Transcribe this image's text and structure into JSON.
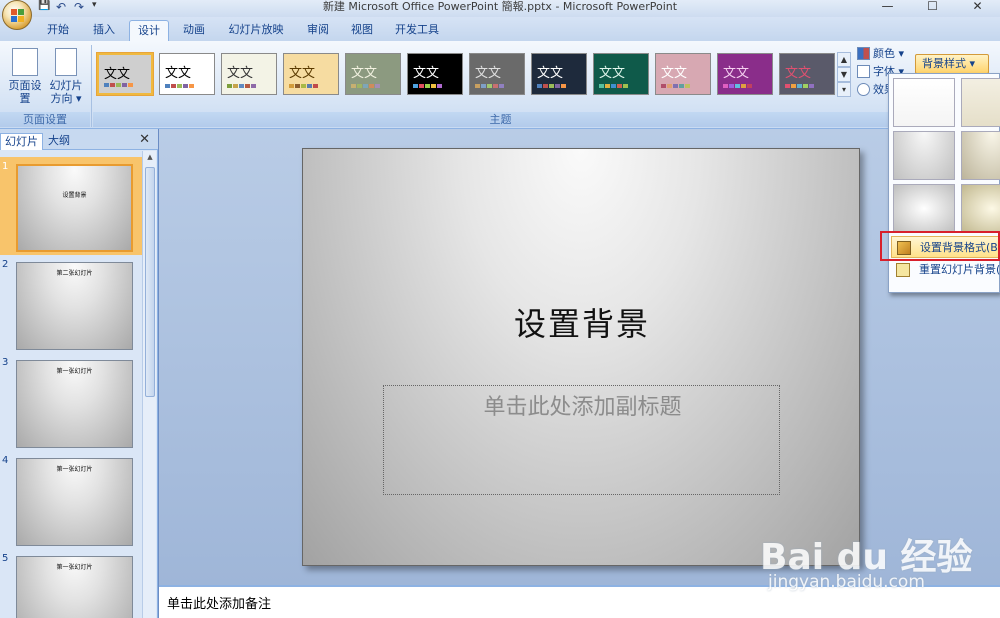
{
  "window": {
    "title": "新建 Microsoft Office PowerPoint 簡報.pptx - Microsoft PowerPoint",
    "controls": [
      "—",
      "☐",
      "✕"
    ]
  },
  "qat_glyphs": [
    "💾",
    "↶",
    "↷",
    "▾"
  ],
  "tabs": [
    "开始",
    "插入",
    "设计",
    "动画",
    "幻灯片放映",
    "审阅",
    "视图",
    "开发工具"
  ],
  "active_tab": "设计",
  "ribbon": {
    "page_setup": {
      "group_label": "页面设置",
      "page_setup_btn": "页面设置",
      "orientation_btn_line1": "幻灯片",
      "orientation_btn_line2": "方向 ▾"
    },
    "themes": {
      "group_label": "主题",
      "items": [
        {
          "text": "文文",
          "bg": "#cfcfcf",
          "fg": "#000000",
          "bars": [
            "#4f81bd",
            "#c0504d",
            "#9bbb59",
            "#8064a2",
            "#f79646"
          ],
          "selected": true
        },
        {
          "text": "文文",
          "bg": "#ffffff",
          "fg": "#000000",
          "bars": [
            "#4f81bd",
            "#c0504d",
            "#9bbb59",
            "#8064a2",
            "#f79646"
          ],
          "selected": false
        },
        {
          "text": "文文",
          "bg": "#f3f3e6",
          "fg": "#333333",
          "bars": [
            "#7d9f3c",
            "#c6a34b",
            "#5f8ac1",
            "#b55a41",
            "#8f6aa8"
          ],
          "selected": false
        },
        {
          "text": "文文",
          "bg": "#f6dca1",
          "fg": "#5a3a00",
          "bars": [
            "#d39c3b",
            "#8a5c2e",
            "#a8b847",
            "#5a7bb0",
            "#c14a4a"
          ],
          "selected": false
        },
        {
          "text": "文文",
          "bg": "#8c9a80",
          "fg": "#f2f2e0",
          "bars": [
            "#c7b071",
            "#9fb464",
            "#7ea6b8",
            "#d08b5b",
            "#a48db5"
          ],
          "selected": false
        },
        {
          "text": "文文",
          "bg": "#000000",
          "fg": "#ffffff",
          "bars": [
            "#4fa3e0",
            "#e04f5f",
            "#9ad04b",
            "#f0c040",
            "#b06ad0"
          ],
          "selected": false
        },
        {
          "text": "文文",
          "bg": "#6a6a6a",
          "fg": "#e0e0e0",
          "bars": [
            "#c8a060",
            "#7fa0c8",
            "#a0c870",
            "#c87070",
            "#9080c0"
          ],
          "selected": false
        },
        {
          "text": "文文",
          "bg": "#1e2a3c",
          "fg": "#ffffff",
          "bars": [
            "#4f81bd",
            "#c0504d",
            "#9bbb59",
            "#8064a2",
            "#f79646"
          ],
          "selected": false
        },
        {
          "text": "文文",
          "bg": "#0f5a4a",
          "fg": "#e0f5ec",
          "bars": [
            "#56c0a0",
            "#e0b040",
            "#4090d0",
            "#d06050",
            "#a0c050"
          ],
          "selected": false
        },
        {
          "text": "文文",
          "bg": "#d7a8b2",
          "fg": "#ffffff",
          "bars": [
            "#b04f6a",
            "#e0a070",
            "#8070b0",
            "#60a0a0",
            "#c0c060"
          ],
          "selected": false
        },
        {
          "text": "文文",
          "bg": "#8a2d8a",
          "fg": "#f5d0f0",
          "bars": [
            "#e060c0",
            "#a060e0",
            "#60c0e0",
            "#e0a040",
            "#c04060"
          ],
          "selected": false
        },
        {
          "text": "文文",
          "bg": "#5a5a6a",
          "fg": "#e05070",
          "bars": [
            "#e05070",
            "#f0a040",
            "#60b0d0",
            "#a0d060",
            "#9070c0"
          ],
          "selected": false
        }
      ]
    },
    "small_buttons": {
      "colors": "颜色 ▾",
      "fonts": "字体 ▾",
      "effects": "效果 ▾"
    },
    "background_styles": "背景样式 ▾"
  },
  "dropdown": {
    "swatches": [
      {
        "bg": "linear-gradient(#ffffff,#f4f4f4)"
      },
      {
        "bg": "linear-gradient(#f3efe2,#e5dfc9)"
      },
      {
        "bg": "radial-gradient(ellipse at 50% 0,#f8f8f8 0,#c0c0c0 100%)"
      },
      {
        "bg": "radial-gradient(ellipse at 50% 0,#faf7ea 0,#bcb49a 100%)"
      },
      {
        "bg": "radial-gradient(ellipse at 50% 50%,#ffffff 0,#bebebe 100%)"
      },
      {
        "bg": "radial-gradient(ellipse at 50% 50%,#fdf9e6 0,#c1b88f 100%)"
      }
    ],
    "menu": [
      "设置背景格式(B)...",
      "重置幻灯片背景(R)"
    ]
  },
  "left_panel": {
    "tabs": [
      "幻灯片",
      "大纲"
    ],
    "close": "✕",
    "slides": [
      {
        "num": "1",
        "title": "设置背景"
      },
      {
        "num": "2",
        "title": "第二张幻灯片"
      },
      {
        "num": "3",
        "title": "第一张幻灯片"
      },
      {
        "num": "4",
        "title": "第一张幻灯片"
      },
      {
        "num": "5",
        "title": "第一张幻灯片"
      }
    ]
  },
  "slide": {
    "title": "设置背景",
    "subtitle_placeholder": "单击此处添加副标题"
  },
  "notes_placeholder": "单击此处添加备注",
  "watermark": {
    "brand": "Bai du 经验",
    "url": "jingyan.baidu.com"
  }
}
